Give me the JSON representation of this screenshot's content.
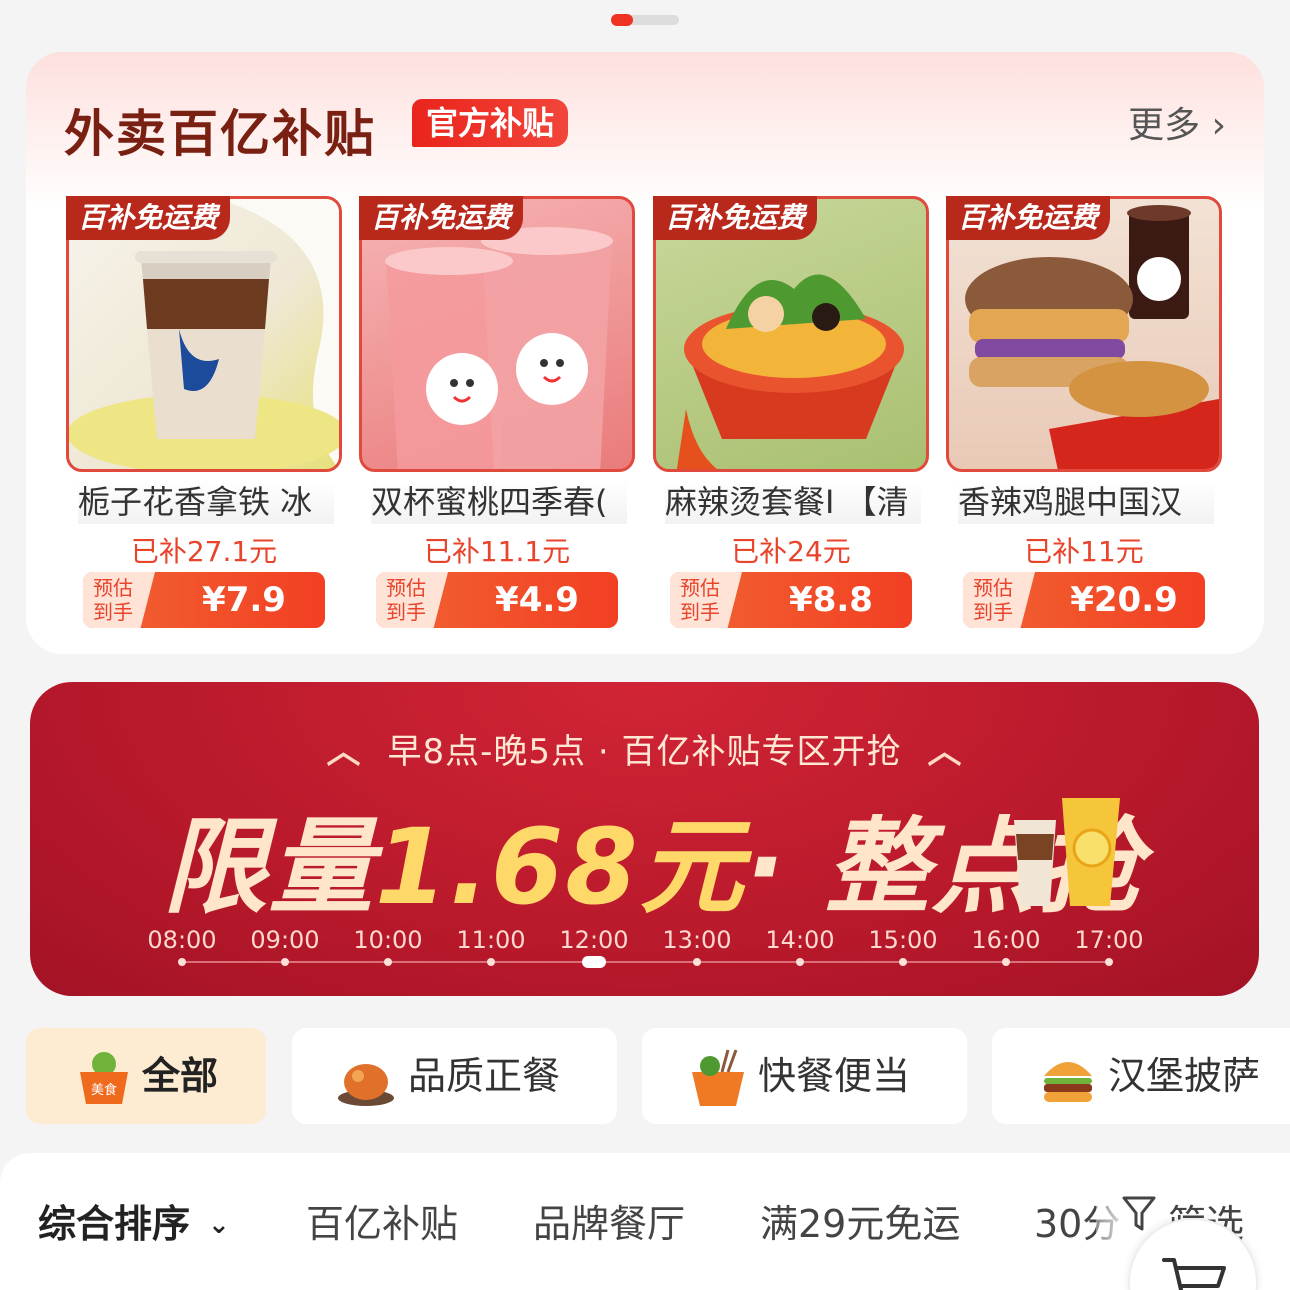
{
  "subsidy": {
    "title": "外卖百亿补贴",
    "badge": "官方补贴",
    "more": "更多 ›",
    "ribbon": "百补免运费",
    "price_label_line1": "预估",
    "price_label_line2": "到手",
    "products": [
      {
        "name": "栀子花香拿铁 冰",
        "subsidy": "已补27.1元",
        "price": "¥7.9"
      },
      {
        "name": "双杯蜜桃四季春(",
        "subsidy": "已补11.1元",
        "price": "¥4.9"
      },
      {
        "name": "麻辣烫套餐I 【清",
        "subsidy": "已补24元",
        "price": "¥8.8"
      },
      {
        "name": "香辣鸡腿中国汉",
        "subsidy": "已补11元",
        "price": "¥20.9"
      }
    ]
  },
  "flash": {
    "subtitle": "早8点-晚5点 · 百亿补贴专区开抢",
    "headline_pre": "限量",
    "headline_highlight": "1.68元",
    "headline_post": "· 整点抢",
    "times": [
      "08:00",
      "09:00",
      "10:00",
      "11:00",
      "12:00",
      "13:00",
      "14:00",
      "15:00",
      "16:00",
      "17:00"
    ],
    "active_time": "12:00"
  },
  "categories": [
    {
      "label": "全部",
      "icon": "food-basket-icon",
      "badge": "美食"
    },
    {
      "label": "品质正餐",
      "icon": "roast-chicken-icon"
    },
    {
      "label": "快餐便当",
      "icon": "takeout-box-icon"
    },
    {
      "label": "汉堡披萨",
      "icon": "burger-icon"
    }
  ],
  "sort": {
    "items": [
      "综合排序",
      "百亿补贴",
      "品牌餐厅",
      "满29元免运",
      "30分"
    ],
    "filter": "筛选"
  },
  "colors": {
    "accent": "#ee3323",
    "banner": "#b8192b",
    "title": "#7a2013"
  }
}
